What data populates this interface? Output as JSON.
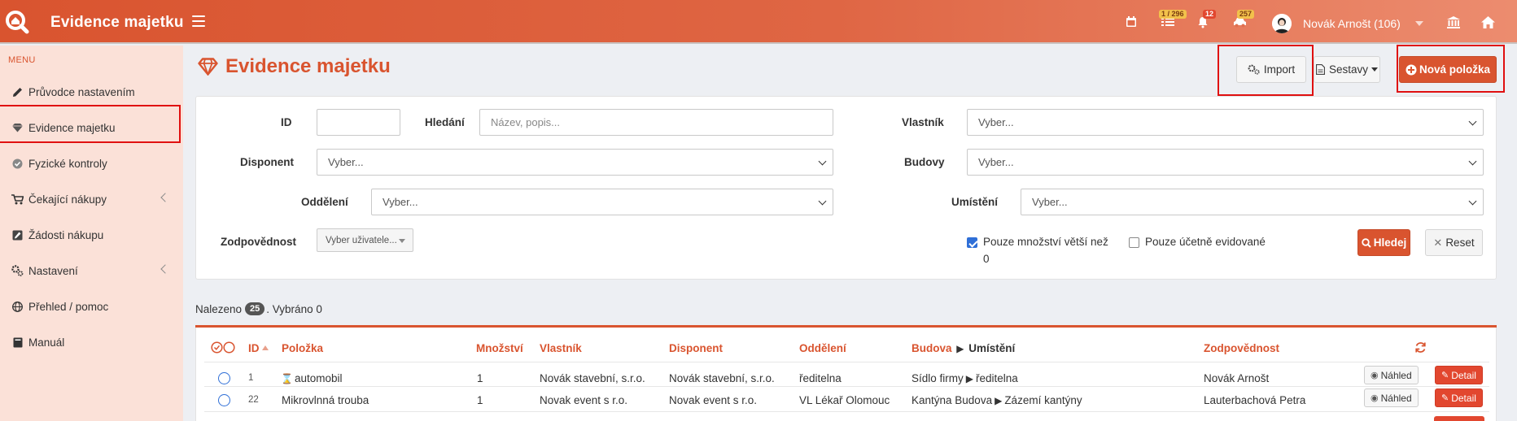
{
  "app": {
    "title": "Evidence majetku",
    "accent_color": "#d9542f",
    "highlight_color": "#e01010"
  },
  "topbar": {
    "calendar_icon": "calendar-icon",
    "tasks_badge": "1 / 296",
    "bell_badge": "12",
    "car_badge": "257",
    "user_name": "Novák Arnošt (106)",
    "bank_icon": "bank-icon",
    "home_icon": "home-icon"
  },
  "sidebar": {
    "menu_label": "MENU",
    "items": [
      {
        "label": "Průvodce nastavením",
        "icon": "pencil-icon"
      },
      {
        "label": "Evidence majetku",
        "icon": "diamond-icon"
      },
      {
        "label": "Fyzické kontroly",
        "icon": "check-circle-icon"
      },
      {
        "label": "Čekající nákupy",
        "icon": "cart-icon"
      },
      {
        "label": "Žádosti nákupu",
        "icon": "edit-icon"
      },
      {
        "label": "Nastavení",
        "icon": "cogs-icon"
      },
      {
        "label": "Přehled / pomoc",
        "icon": "globe-icon"
      },
      {
        "label": "Manuál",
        "icon": "book-icon"
      }
    ]
  },
  "page": {
    "title": "Evidence majetku",
    "import_label": "Import",
    "reports_label": "Sestavy",
    "new_item_label": "Nová položka"
  },
  "filters": {
    "id_label": "ID",
    "id_value": "",
    "search_label": "Hledání",
    "search_placeholder": "Název, popis...",
    "owner_label": "Vlastník",
    "owner_value": "Vyber...",
    "disponent_label": "Disponent",
    "disponent_value": "Vyber...",
    "buildings_label": "Budovy",
    "buildings_value": "Vyber...",
    "department_label": "Oddělení",
    "department_value": "Vyber...",
    "location_label": "Umístění",
    "location_value": "Vyber...",
    "responsibility_label": "Zodpovědnost",
    "responsibility_value": "Vyber uživatele...",
    "qty_checkbox_label_1": "Pouze množství větší než",
    "qty_checkbox_label_2": "0",
    "qty_checked": true,
    "accounting_checkbox_label": "Pouze účetně evidované",
    "accounting_checked": false,
    "search_button": "Hledej",
    "reset_button": "Reset"
  },
  "results": {
    "found_prefix": "Nalezeno",
    "found_count": "25",
    "selected_text": ". Vybráno 0"
  },
  "table": {
    "headers": {
      "id": "ID",
      "item": "Položka",
      "qty": "Množství",
      "owner": "Vlastník",
      "disponent": "Disponent",
      "department": "Oddělení",
      "building": "Budova",
      "location": "Umístění",
      "responsibility": "Zodpovědnost"
    },
    "view_label": "Náhled",
    "detail_label": "Detail",
    "rows": [
      {
        "id": "1",
        "item": "automobil",
        "qty": "1",
        "owner": "Novák stavební, s.r.o.",
        "disponent": "Novák stavební, s.r.o.",
        "department": "ředitelna",
        "building": "Sídlo firmy",
        "location": "ředitelna",
        "responsibility": "Novák Arnošt"
      },
      {
        "id": "22",
        "item": "Mikrovlnná trouba",
        "qty": "1",
        "owner": "Novak event s r.o.",
        "disponent": "Novak event s r.o.",
        "department": "VL Lékař Olomouc",
        "building": "Kantýna Budova",
        "location": "Zázemí kantýny",
        "responsibility": "Lauterbachová Petra"
      }
    ]
  }
}
